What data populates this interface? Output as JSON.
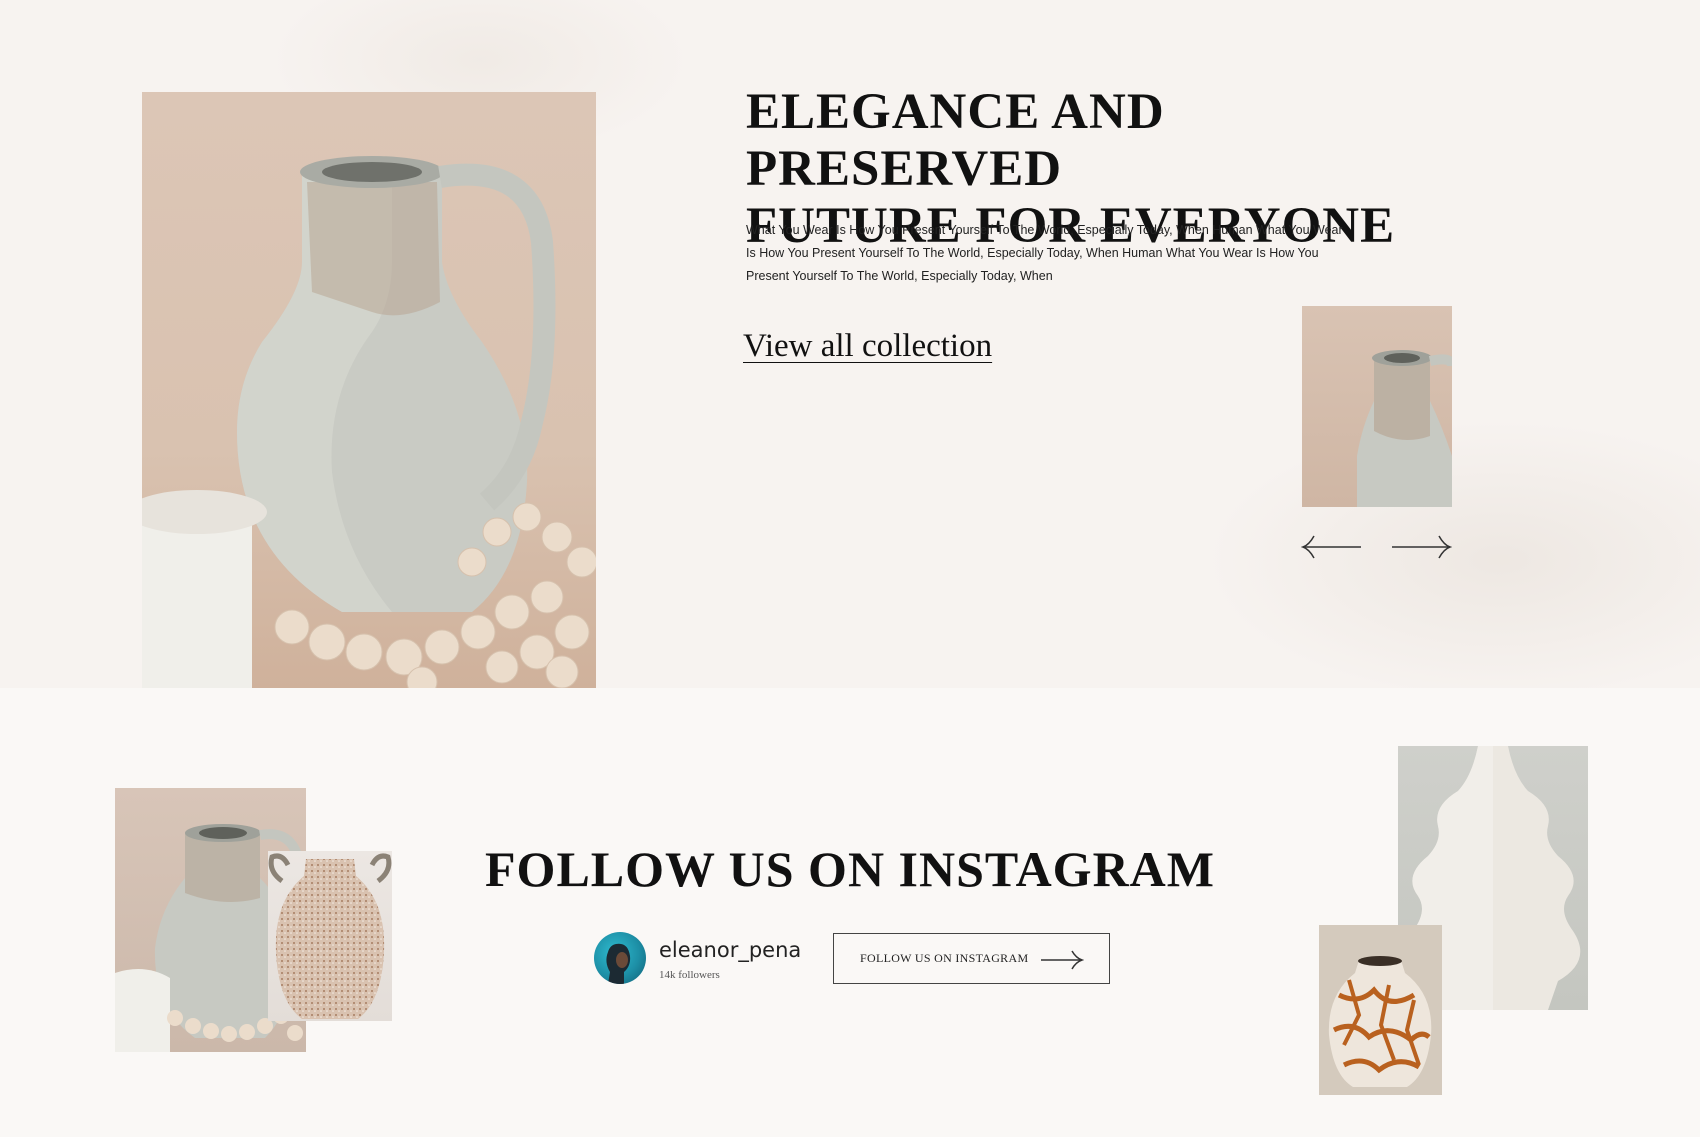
{
  "hero": {
    "title_line1": "ELEGANCE AND PRESERVED",
    "title_line2": "FUTURE FOR EVERYONE",
    "description": "What You Wear Is How You Present Yourself To The World, Especially Today, When Human What You Wear Is How You Present Yourself To The World, Especially Today, When Human What You Wear Is How You Present Yourself To The World, Especially Today, When",
    "link_label": "View all collection",
    "main_image": "ceramic-jug-with-beads-photo",
    "thumbnail_image": "ceramic-jug-thumbnail",
    "prev_icon": "arrow-left-icon",
    "next_icon": "arrow-right-icon"
  },
  "instagram": {
    "title": "FOLLOW US ON INSTAGRAM",
    "username": "eleanor_pena",
    "followers": "14k followers",
    "button_label": "FOLLOW US ON INSTAGRAM",
    "button_icon": "arrow-right-icon",
    "images": [
      "ceramic-jug-photo",
      "speckled-vase-photo",
      "white-stacked-vase-photo",
      "crackle-vase-photo"
    ]
  },
  "colors": {
    "background": "#faf8f6",
    "hero_background": "#f7f3f0",
    "text": "#111111",
    "accent_avatar": "#1d8fa6"
  }
}
